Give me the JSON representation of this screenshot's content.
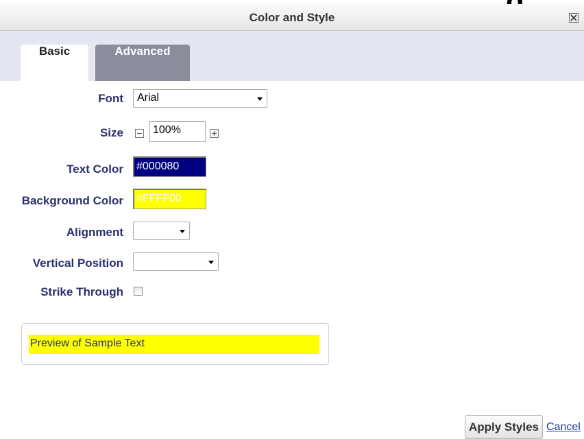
{
  "dialog": {
    "title": "Color and Style",
    "close_icon": "close-icon"
  },
  "tabs": [
    {
      "label": "Basic",
      "active": true
    },
    {
      "label": "Advanced",
      "active": false
    }
  ],
  "form": {
    "font": {
      "label": "Font",
      "value": "Arial"
    },
    "size": {
      "label": "Size",
      "value": "100%",
      "decrement_icon": "minus-icon",
      "increment_icon": "plus-icon"
    },
    "text_color": {
      "label": "Text Color",
      "value": "#000080",
      "color": "#000080",
      "text_color": "#ffffff"
    },
    "background_color": {
      "label": "Background Color",
      "value": "#FFFF00",
      "color": "#FFFF00",
      "text_color": "#ffffff"
    },
    "alignment": {
      "label": "Alignment",
      "value": ""
    },
    "vertical_position": {
      "label": "Vertical Position",
      "value": ""
    },
    "strike_through": {
      "label": "Strike Through",
      "checked": false
    }
  },
  "preview": {
    "text": "Preview of Sample Text",
    "text_color": "#2a2f6e",
    "background": "#ffff00"
  },
  "actions": {
    "apply_label": "Apply Styles",
    "cancel_label": "Cancel"
  },
  "colors": {
    "label": "#2a2f6e",
    "tab_bar": "#e4e6f2",
    "tab_inactive": "#8a8d9b",
    "link": "#1a3aa8"
  }
}
